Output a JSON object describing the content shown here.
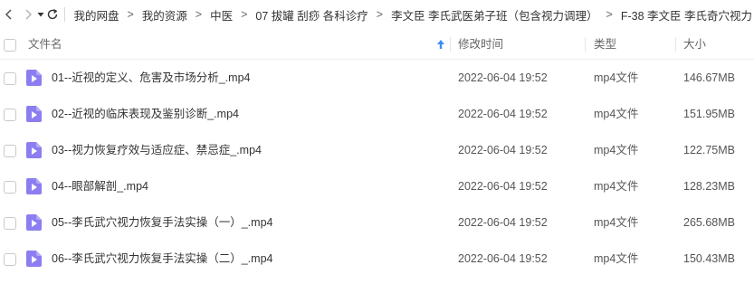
{
  "toolbar": {
    "back_icon": "back-arrow-icon",
    "forward_icon": "forward-arrow-icon",
    "history_icon": "dropdown-triangle-icon",
    "refresh_icon": "refresh-icon"
  },
  "breadcrumb": {
    "separator": ">",
    "items": [
      "我的网盘",
      "我的资源",
      "中医",
      "07 拔罐 刮痧 各科诊疗",
      "李文臣 李氏武医弟子班（包含视力调理）",
      "F-38 李文臣 李氏奇穴视力"
    ]
  },
  "columns": {
    "name": "文件名",
    "modified": "修改时间",
    "type": "类型",
    "size": "大小",
    "sort_icon": "sort-ascending-arrow-icon"
  },
  "colors": {
    "file_icon": "#8c7ef0",
    "sort_arrow": "#3a8ff5"
  },
  "files": [
    {
      "name": "01--近视的定义、危害及市场分析_.mp4",
      "modified": "2022-06-04 19:52",
      "type": "mp4文件",
      "size": "146.67MB",
      "icon": "video-file-icon"
    },
    {
      "name": "02--近视的临床表现及鉴别诊断_.mp4",
      "modified": "2022-06-04 19:52",
      "type": "mp4文件",
      "size": "151.95MB",
      "icon": "video-file-icon"
    },
    {
      "name": "03--视力恢复疗效与适应症、禁忌症_.mp4",
      "modified": "2022-06-04 19:52",
      "type": "mp4文件",
      "size": "122.75MB",
      "icon": "video-file-icon"
    },
    {
      "name": "04--眼部解剖_.mp4",
      "modified": "2022-06-04 19:52",
      "type": "mp4文件",
      "size": "128.23MB",
      "icon": "video-file-icon"
    },
    {
      "name": "05--李氏武穴视力恢复手法实操（一）_.mp4",
      "modified": "2022-06-04 19:52",
      "type": "mp4文件",
      "size": "265.68MB",
      "icon": "video-file-icon"
    },
    {
      "name": "06--李氏武穴视力恢复手法实操（二）_.mp4",
      "modified": "2022-06-04 19:52",
      "type": "mp4文件",
      "size": "150.43MB",
      "icon": "video-file-icon"
    }
  ]
}
